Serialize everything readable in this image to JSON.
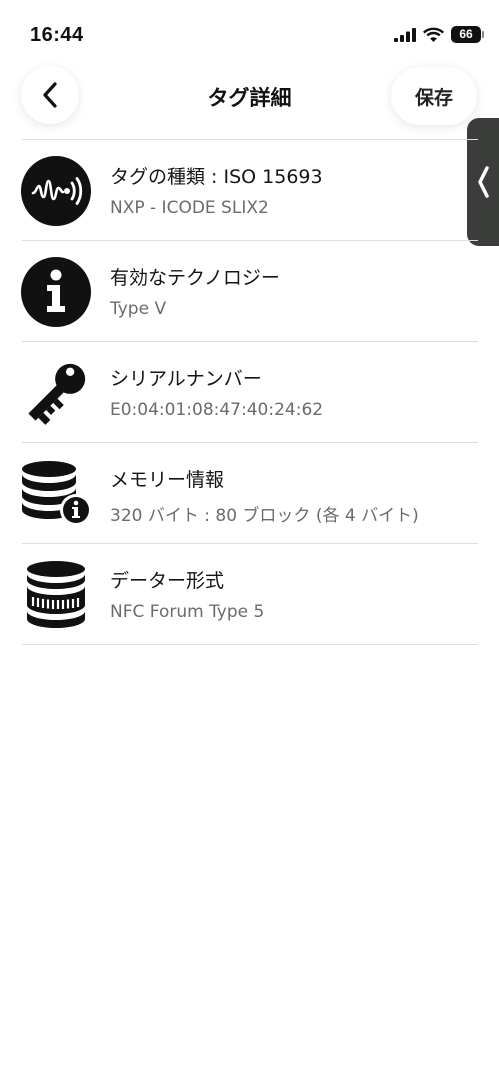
{
  "status_bar": {
    "time": "16:44",
    "battery": "66",
    "signal_icon": "cellular-signal-icon",
    "wifi_icon": "wifi-icon"
  },
  "nav": {
    "title": "タグ詳細",
    "save_label": "保存",
    "back_icon": "chevron-left-icon"
  },
  "side_handle": {
    "icon": "chevron-left-icon"
  },
  "rows": [
    {
      "icon": "nfc-tag-icon",
      "title": "タグの種類 : ISO 15693",
      "subtitle": "NXP - ICODE SLIX2"
    },
    {
      "icon": "info-icon",
      "title": "有効なテクノロジー",
      "subtitle": "Type V"
    },
    {
      "icon": "key-icon",
      "title": "シリアルナンバー",
      "subtitle": "E0:04:01:08:47:40:24:62"
    },
    {
      "icon": "database-info-icon",
      "title": "メモリー情報",
      "subtitle": "320 バイト : 80 ブロック (各 4 バイト)"
    },
    {
      "icon": "database-icon",
      "title": "データー形式",
      "subtitle": "NFC Forum Type 5"
    }
  ]
}
